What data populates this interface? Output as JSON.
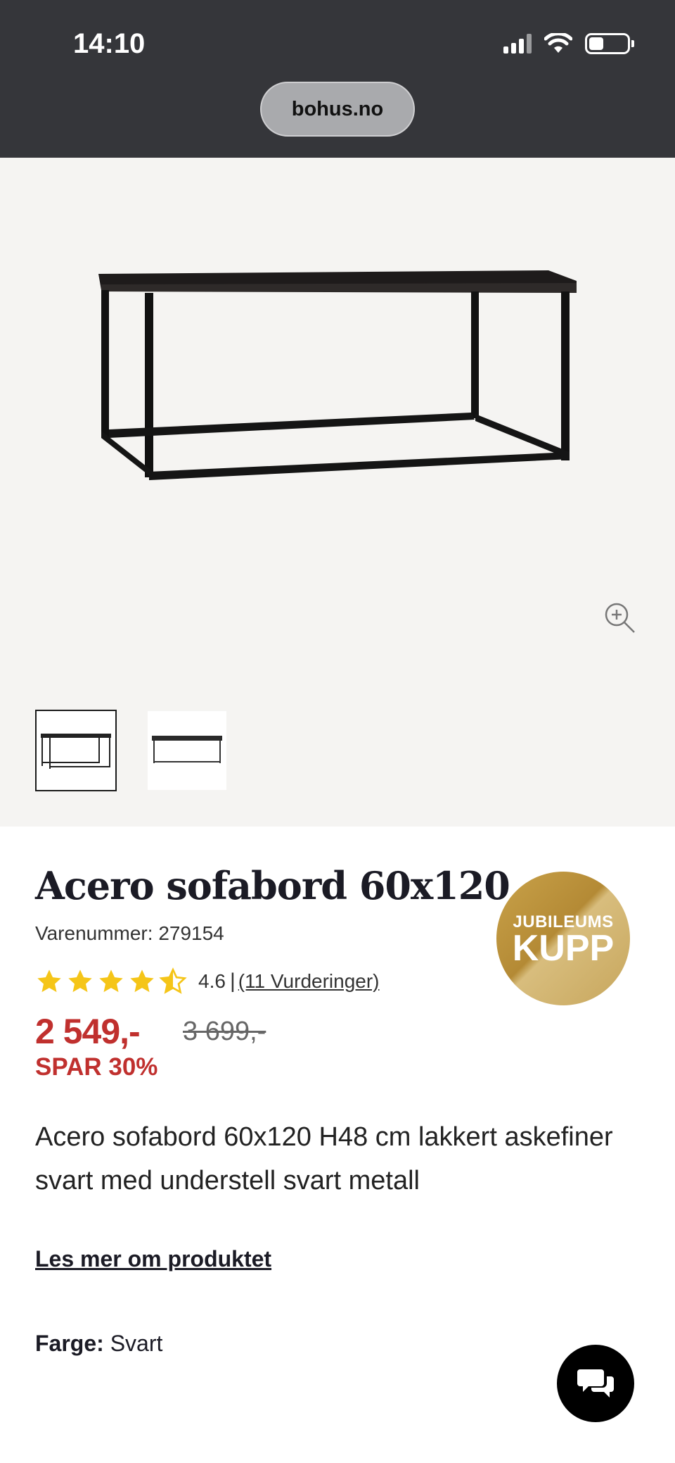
{
  "status_bar": {
    "time": "14:10",
    "icons": [
      "signal-icon",
      "wifi-icon",
      "battery-icon"
    ]
  },
  "browser": {
    "url": "bohus.no"
  },
  "gallery": {
    "main_image": "coffee-table-image",
    "thumbnails": [
      "thumbnail-1",
      "thumbnail-2"
    ],
    "active_thumbnail": 0,
    "zoom_icon": "zoom-in-icon"
  },
  "product": {
    "title": "Acero sofabord 60x120",
    "sku": "Varenummer: 279154",
    "rating_value": "4.6",
    "rating_fraction": 0.92,
    "rating_separator": "|",
    "reviews_label": "(11 Vurderinger)",
    "price": "2 549,-",
    "old_price": "3 699,-",
    "save_label": "SPAR 30%",
    "badge_top": "JUBILEUMS",
    "badge_main": "KUPP",
    "description": "Acero sofabord 60x120 H48 cm lakkert askefiner svart med understell svart metall",
    "read_more": "Les mer om produktet",
    "color_label": "Farge:",
    "color_value": "Svart"
  },
  "colors": {
    "sale_red": "#c0302e",
    "star_yellow": "#f5c518",
    "badge_gold": "#c9a24a",
    "status_bar_bg": "#35363a"
  },
  "chat": {
    "icon": "chat-icon"
  }
}
